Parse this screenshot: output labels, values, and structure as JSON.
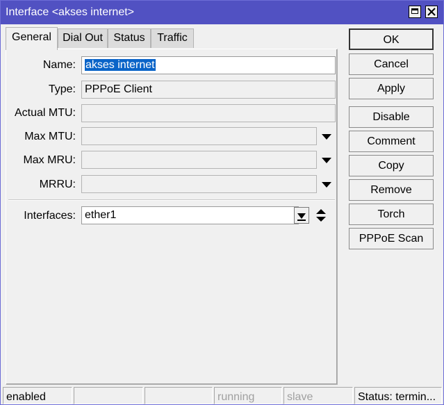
{
  "window": {
    "title": "Interface <akses internet>"
  },
  "tabs": [
    {
      "label": "General",
      "active": true
    },
    {
      "label": "Dial Out",
      "active": false
    },
    {
      "label": "Status",
      "active": false
    },
    {
      "label": "Traffic",
      "active": false
    }
  ],
  "form": {
    "name_label": "Name:",
    "name_value": "akses internet",
    "type_label": "Type:",
    "type_value": "PPPoE Client",
    "actual_mtu_label": "Actual MTU:",
    "actual_mtu_value": "",
    "max_mtu_label": "Max MTU:",
    "max_mtu_value": "",
    "max_mru_label": "Max MRU:",
    "max_mru_value": "",
    "mrru_label": "MRRU:",
    "mrru_value": "",
    "interfaces_label": "Interfaces:",
    "interfaces_value": "ether1"
  },
  "buttons": {
    "ok": "OK",
    "cancel": "Cancel",
    "apply": "Apply",
    "disable": "Disable",
    "comment": "Comment",
    "copy": "Copy",
    "remove": "Remove",
    "torch": "Torch",
    "pppoe_scan": "PPPoE Scan"
  },
  "status": {
    "state": "enabled",
    "cell2": "",
    "cell3": "",
    "running": "running",
    "slave": "slave",
    "status_text": "Status: termin..."
  },
  "colors": {
    "titlebar": "#5151c2",
    "selection": "#0a64c8",
    "background": "#f0f0f0"
  }
}
